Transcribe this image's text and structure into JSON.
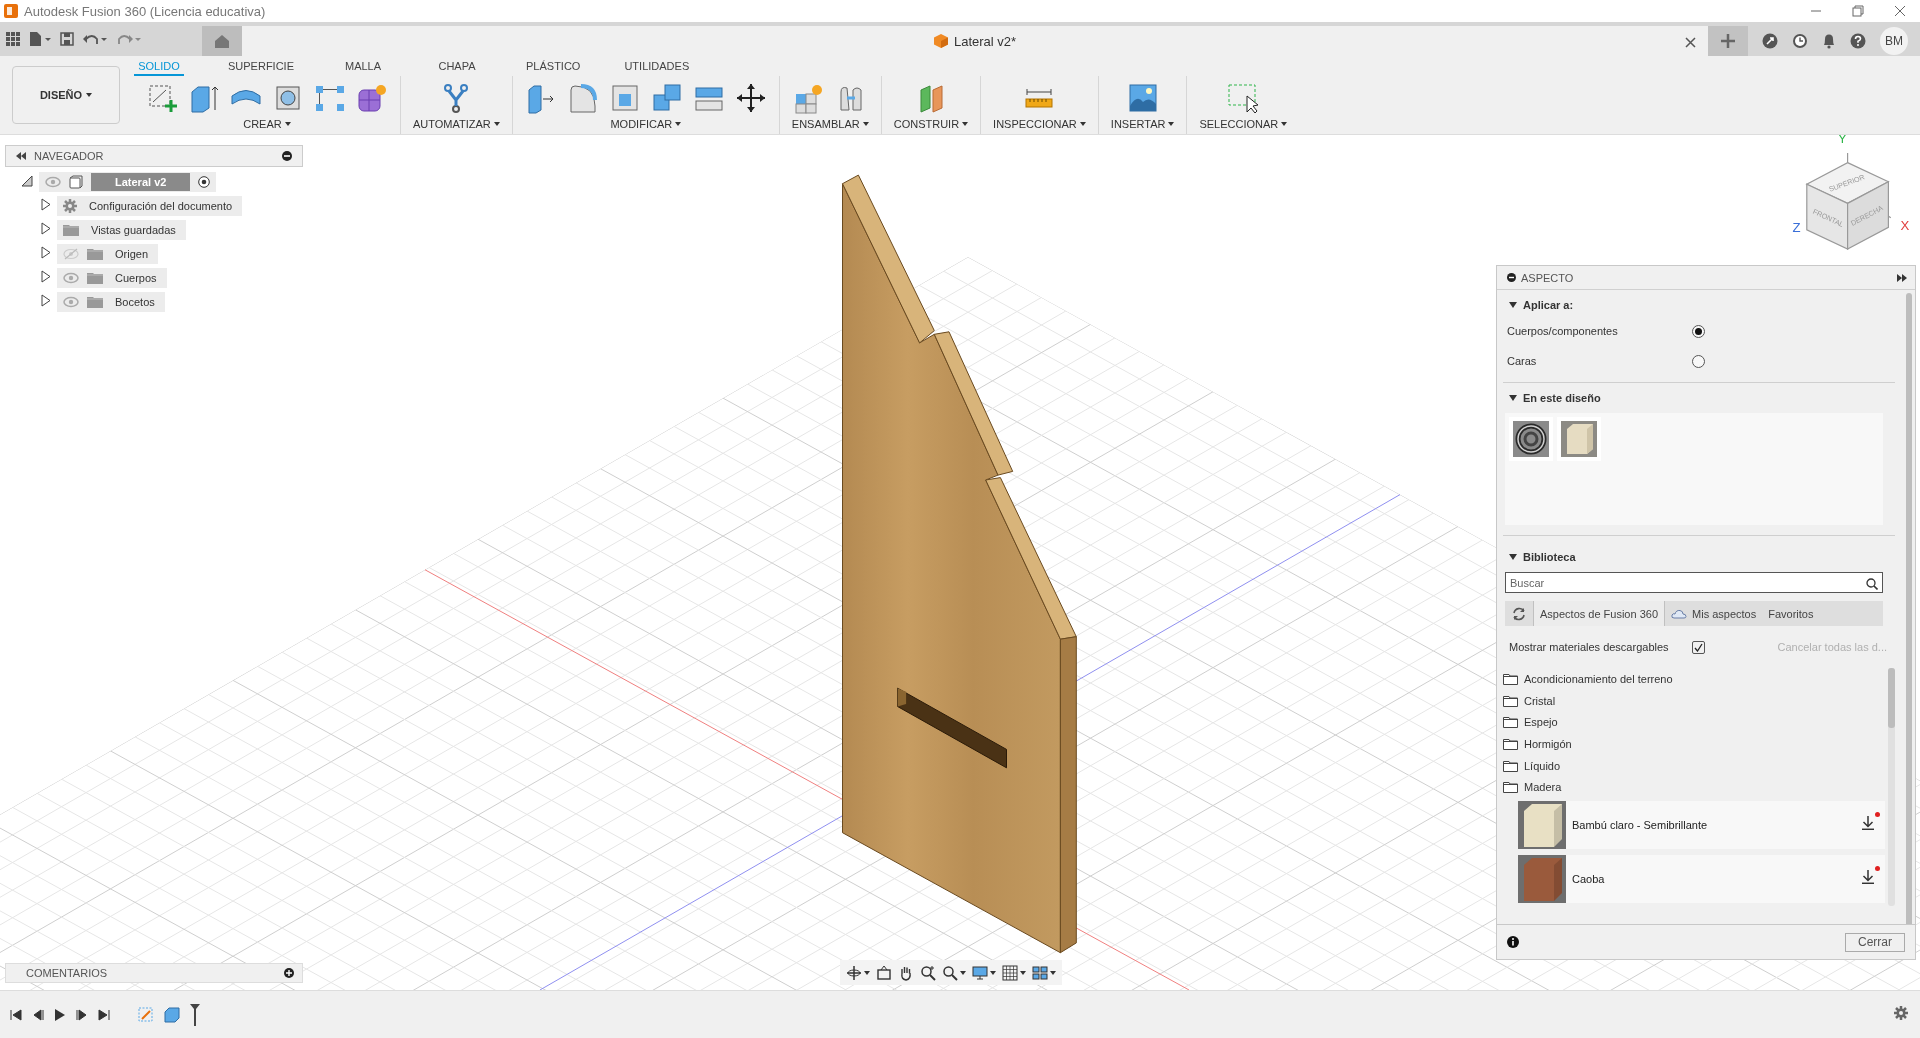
{
  "window": {
    "title": "Autodesk Fusion 360 (Licencia educativa)"
  },
  "document_tab": {
    "title": "Lateral v2*"
  },
  "user": {
    "initials": "BM"
  },
  "ribbon": {
    "workspace": "DISEÑO",
    "tabs": [
      {
        "label": "SOLIDO",
        "selected": true
      },
      {
        "label": "SUPERFICIE",
        "selected": false
      },
      {
        "label": "MALLA",
        "selected": false
      },
      {
        "label": "CHAPA",
        "selected": false
      },
      {
        "label": "PLÁSTICO",
        "selected": false
      },
      {
        "label": "UTILIDADES",
        "selected": false
      }
    ],
    "groups": [
      {
        "label": "CREAR"
      },
      {
        "label": "AUTOMATIZAR"
      },
      {
        "label": "MODIFICAR"
      },
      {
        "label": "ENSAMBLAR"
      },
      {
        "label": "CONSTRUIR"
      },
      {
        "label": "INSPECCIONAR"
      },
      {
        "label": "INSERTAR"
      },
      {
        "label": "SELECCIONAR"
      }
    ]
  },
  "navigator": {
    "title": "NAVEGADOR",
    "root": {
      "label": "Lateral v2",
      "expanded": true
    },
    "items": [
      {
        "label": "Configuración del documento",
        "kind": "settings",
        "expanded": false
      },
      {
        "label": "Vistas guardadas",
        "kind": "folder",
        "expanded": false
      },
      {
        "label": "Origen",
        "kind": "folder",
        "visible": false,
        "expanded": false
      },
      {
        "label": "Cuerpos",
        "kind": "folder",
        "visible": true,
        "expanded": false
      },
      {
        "label": "Bocetos",
        "kind": "folder",
        "visible": true,
        "expanded": false
      }
    ]
  },
  "viewcube": {
    "faces": [
      "SUPERIOR",
      "FRONTAL",
      "DERECHA"
    ],
    "axes": [
      "Y",
      "Z",
      "X"
    ]
  },
  "appearance": {
    "title": "ASPECTO",
    "apply_to": {
      "title": "Aplicar a:",
      "expanded": true,
      "options": [
        {
          "label": "Cuerpos/componentes",
          "selected": true
        },
        {
          "label": "Caras",
          "selected": false
        }
      ]
    },
    "in_design": {
      "title": "En este diseño",
      "expanded": true,
      "swatches": [
        {
          "kind": "metal"
        },
        {
          "kind": "cube"
        }
      ]
    },
    "library": {
      "title": "Biblioteca",
      "expanded": true,
      "search": {
        "placeholder": "Buscar"
      },
      "tabs": [
        {
          "label": "Aspectos de Fusion 360",
          "selected": true
        },
        {
          "label": "Mis aspectos",
          "selected": false
        },
        {
          "label": "Favoritos",
          "selected": false
        }
      ],
      "show_downloadable": {
        "label": "Mostrar materiales descargables",
        "checked": true
      },
      "cancel_downloads": {
        "label": "Cancelar todas las d...",
        "disabled": true
      },
      "folders": [
        "Acondicionamiento del terreno",
        "Cristal",
        "Espejo",
        "Hormigón",
        "Líquido",
        "Madera"
      ],
      "materials": [
        {
          "name": "Bambú claro - Semibrillante",
          "color": "#e8e0c4"
        },
        {
          "name": "Caoba",
          "color": "#9a5a3c"
        }
      ]
    },
    "close_button": "Cerrar"
  },
  "comments": {
    "title": "COMENTARIOS"
  }
}
